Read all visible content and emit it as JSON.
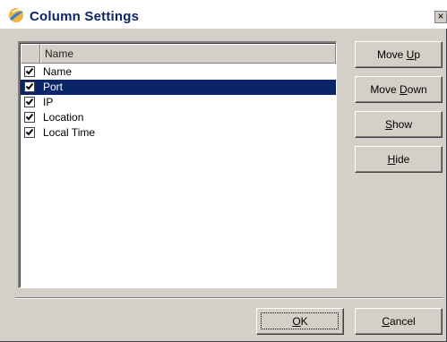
{
  "window": {
    "title": "Column Settings",
    "close_glyph": "×"
  },
  "list": {
    "header": "Name",
    "rows": [
      {
        "label": "Name",
        "checked": true,
        "selected": false
      },
      {
        "label": "Port",
        "checked": true,
        "selected": true
      },
      {
        "label": "IP",
        "checked": true,
        "selected": false
      },
      {
        "label": "Location",
        "checked": true,
        "selected": false
      },
      {
        "label": "Local Time",
        "checked": true,
        "selected": false
      }
    ]
  },
  "buttons": {
    "move_up": {
      "label": "Move Up",
      "accel": "U"
    },
    "move_down": {
      "label": "Move Down",
      "accel": "D"
    },
    "show": {
      "label": "Show",
      "accel": "S"
    },
    "hide": {
      "label": "Hide",
      "accel": "H"
    },
    "ok": {
      "label": "OK",
      "accel": "O"
    },
    "cancel": {
      "label": "Cancel",
      "accel": "C"
    }
  },
  "icons": {
    "app": "app-logo-icon",
    "check": "check-icon",
    "close": "close-icon"
  },
  "colors": {
    "title": "#0a246a",
    "selection": "#0a246a",
    "face": "#d4d0c8"
  }
}
